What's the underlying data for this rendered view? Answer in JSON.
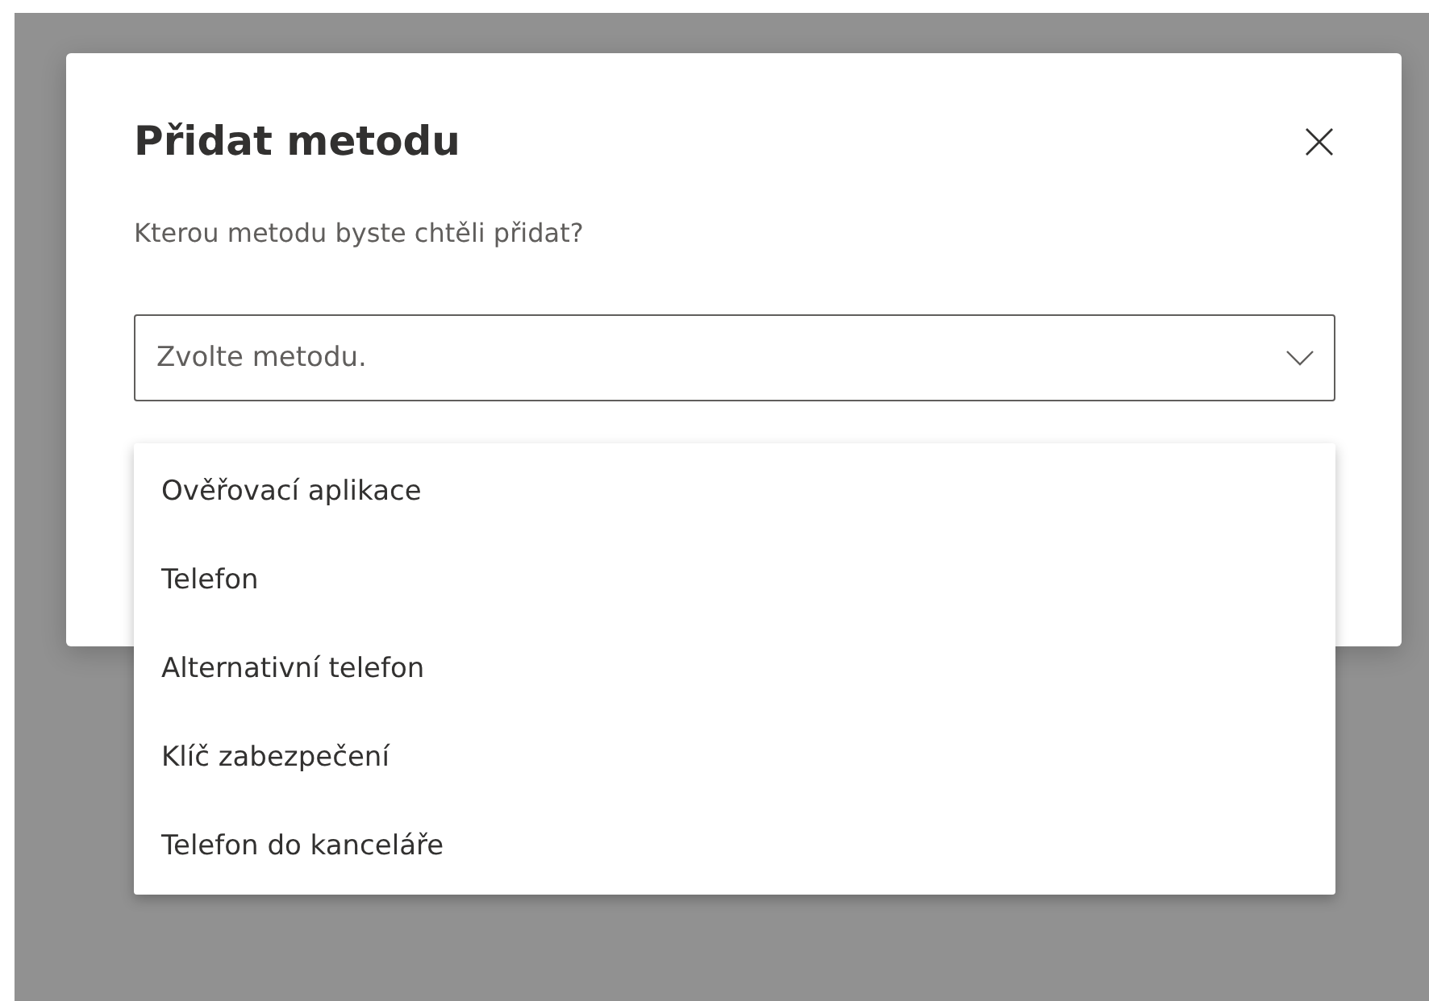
{
  "dialog": {
    "title": "Přidat metodu",
    "question": "Kterou metodu byste chtěli přidat?",
    "select": {
      "placeholder": "Zvolte metodu.",
      "expanded": true,
      "options": [
        {
          "label": "Ověřovací aplikace"
        },
        {
          "label": "Telefon"
        },
        {
          "label": "Alternativní telefon"
        },
        {
          "label": "Klíč zabezpečení"
        },
        {
          "label": "Telefon do kanceláře"
        }
      ]
    }
  }
}
